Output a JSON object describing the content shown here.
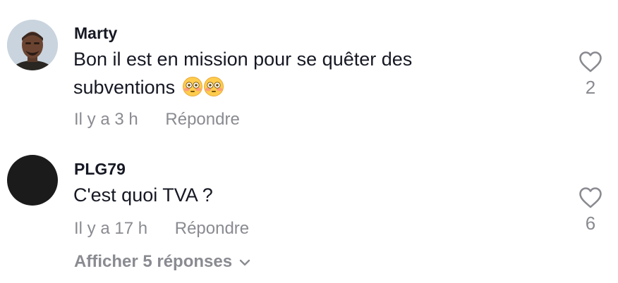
{
  "comments": [
    {
      "username": "Marty",
      "text": "Bon il est en mission pour se quêter des subventions",
      "emoji": "😳😳",
      "time": "Il y a 3 h",
      "reply_label": "Répondre",
      "likes": "2",
      "avatar": "profile-photo"
    },
    {
      "username": "PLG79",
      "text": "C'est quoi TVA ?",
      "time": "Il y a 17 h",
      "reply_label": "Répondre",
      "likes": "6",
      "avatar": "dark-circle"
    }
  ],
  "show_replies_label": "Afficher 5 réponses",
  "colors": {
    "text": "#161823",
    "muted": "#8a8b91",
    "like_outline": "#8a8b91"
  },
  "icons": {
    "like": "heart-outline-icon",
    "expand": "chevron-down-icon"
  }
}
